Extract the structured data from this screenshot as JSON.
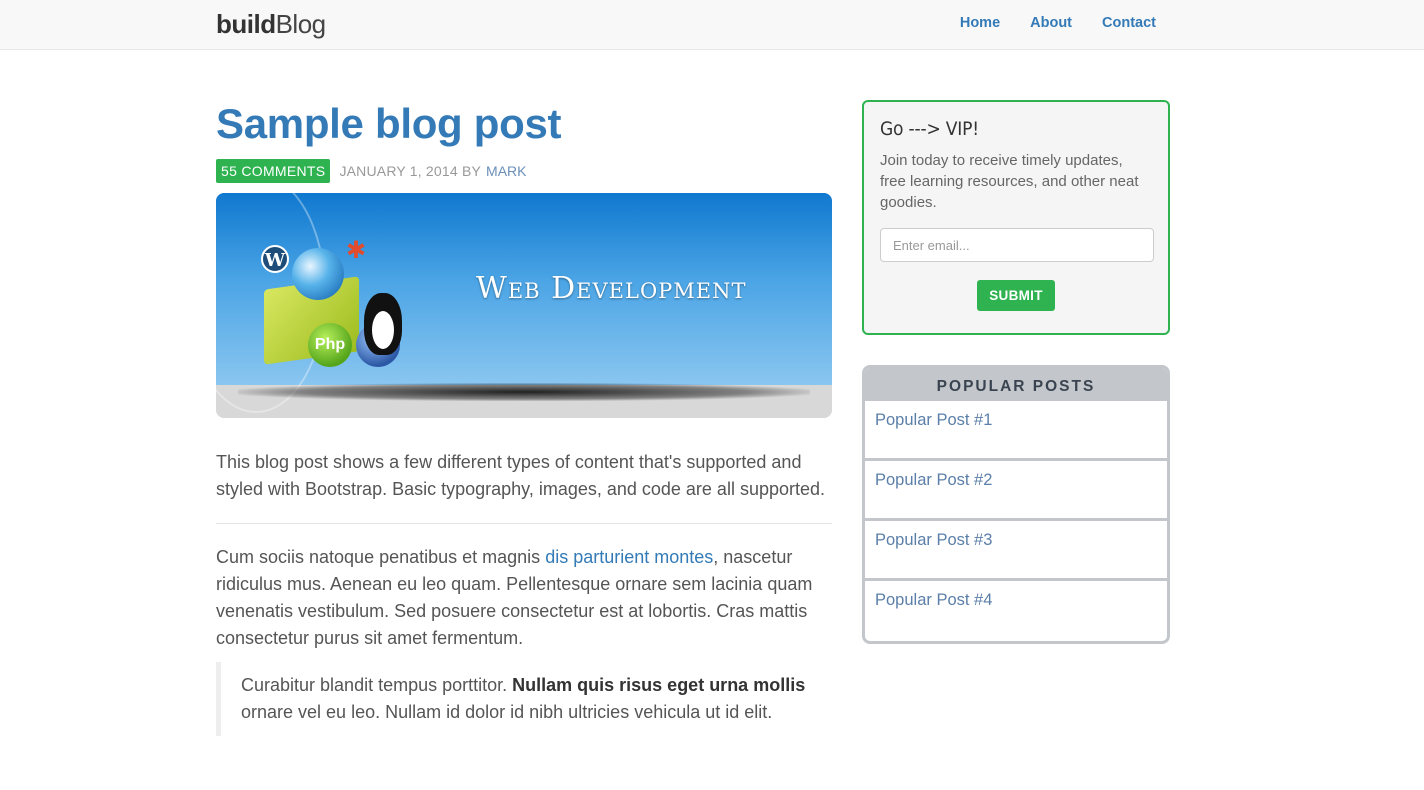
{
  "navbar": {
    "brand_bold": "build",
    "brand_light": "Blog",
    "links": [
      {
        "label": "Home"
      },
      {
        "label": "About"
      },
      {
        "label": "Contact"
      }
    ]
  },
  "post": {
    "title": "Sample blog post",
    "comments_badge": "55 COMMENTS",
    "date": "JANUARY 1, 2014 BY",
    "author": "MARK",
    "hero_text": "Web Development",
    "lead": "This blog post shows a few different types of content that's supported and styled with Bootstrap. Basic typography, images, and code are all supported.",
    "para_before_link": "Cum sociis natoque penatibus et magnis ",
    "para_link": "dis parturient montes",
    "para_after_link": ", nascetur ridiculus mus. Aenean eu leo quam. Pellentesque ornare sem lacinia quam venenatis vestibulum. Sed posuere consectetur est at lobortis. Cras mattis consectetur purus sit amet fermentum.",
    "quote_before": "Curabitur blandit tempus porttitor. ",
    "quote_bold": "Nullam quis risus eget urna mollis",
    "quote_after": " ornare vel eu leo. Nullam id dolor id nibh ultricies vehicula ut id elit."
  },
  "vip": {
    "title": "Go ---> VIP!",
    "description": "Join today to receive timely updates, free learning resources, and other neat goodies.",
    "email_placeholder": "Enter email...",
    "submit_label": "SUBMIT"
  },
  "popular": {
    "heading": "POPULAR POSTS",
    "items": [
      {
        "label": "Popular Post #1"
      },
      {
        "label": "Popular Post #2"
      },
      {
        "label": "Popular Post #3"
      },
      {
        "label": "Popular Post #4"
      }
    ]
  },
  "colors": {
    "accent_blue": "#337ab7",
    "accent_green": "#2fb350",
    "sidebar_gray": "#c3c7cc"
  }
}
